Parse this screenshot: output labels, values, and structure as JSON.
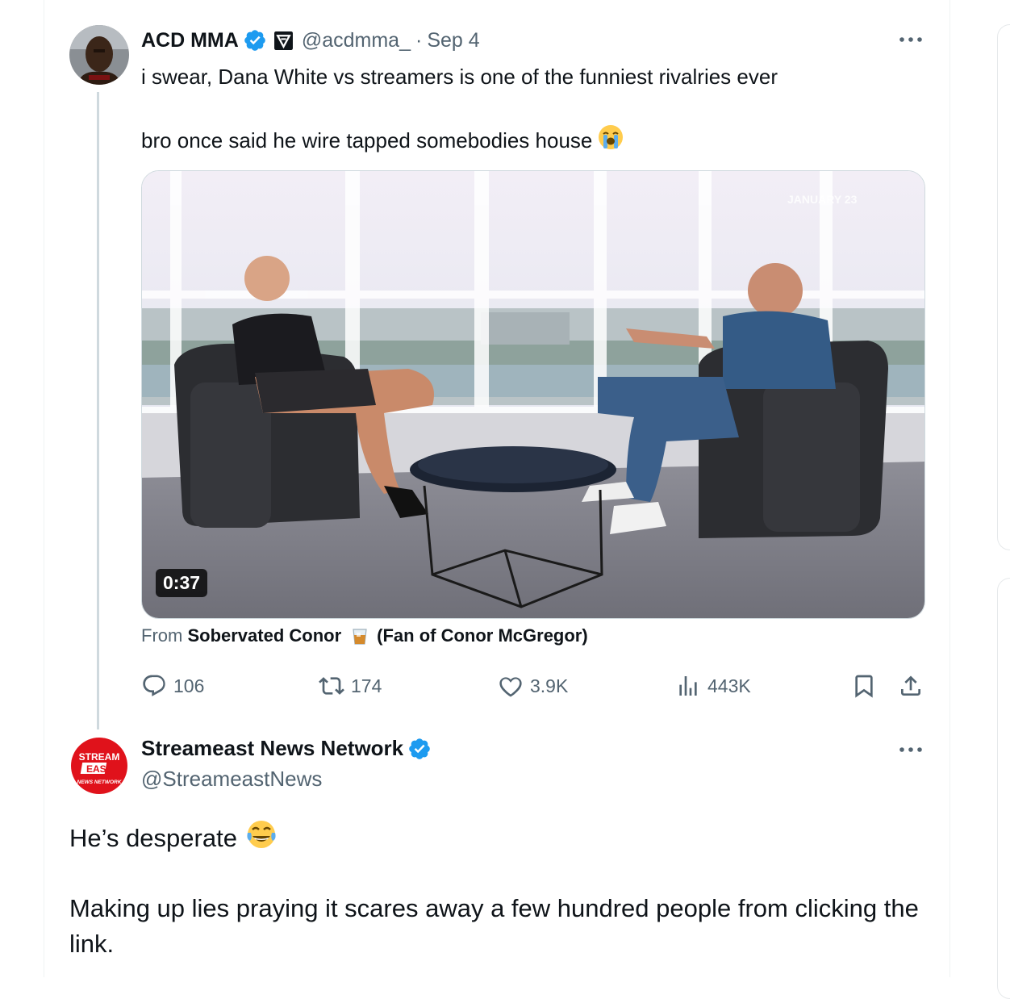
{
  "tweet1": {
    "author_name": "ACD MMA",
    "handle": "@acdmma_",
    "separator": "·",
    "date": "Sep 4",
    "text_line1": "i swear, Dana White vs streamers is one of the funniest rivalries ever",
    "text_line2": "bro once said he wire tapped somebodies house",
    "media": {
      "duration": "0:37",
      "overlay_text": "JANUARY 23"
    },
    "source": {
      "prefix": "From",
      "name": "Sobervated Conor",
      "suffix": "(Fan of Conor McGregor)"
    },
    "actions": {
      "replies": "106",
      "reposts": "174",
      "likes": "3.9K",
      "views": "443K"
    },
    "icons": [
      "verified-badge-icon",
      "affiliate-badge-icon",
      "more-icon",
      "crying-face-emoji",
      "reply-icon",
      "repost-icon",
      "like-icon",
      "views-icon",
      "bookmark-icon",
      "share-icon"
    ]
  },
  "tweet2": {
    "author_name": "Streameast News Network",
    "handle": "@StreameastNews",
    "avatar_text": {
      "line1": "STREAM",
      "line2": "EAST",
      "line3": "NEWS NETWORK"
    },
    "text_line1": "He’s desperate",
    "text_para2": "Making up lies praying it scares away a few hundred people from clicking the link."
  },
  "colors": {
    "text": "#0f1419",
    "secondary": "#536471",
    "verified": "#1d9bf0",
    "border": "#cfd9de",
    "streameast_red": "#e0121b"
  }
}
